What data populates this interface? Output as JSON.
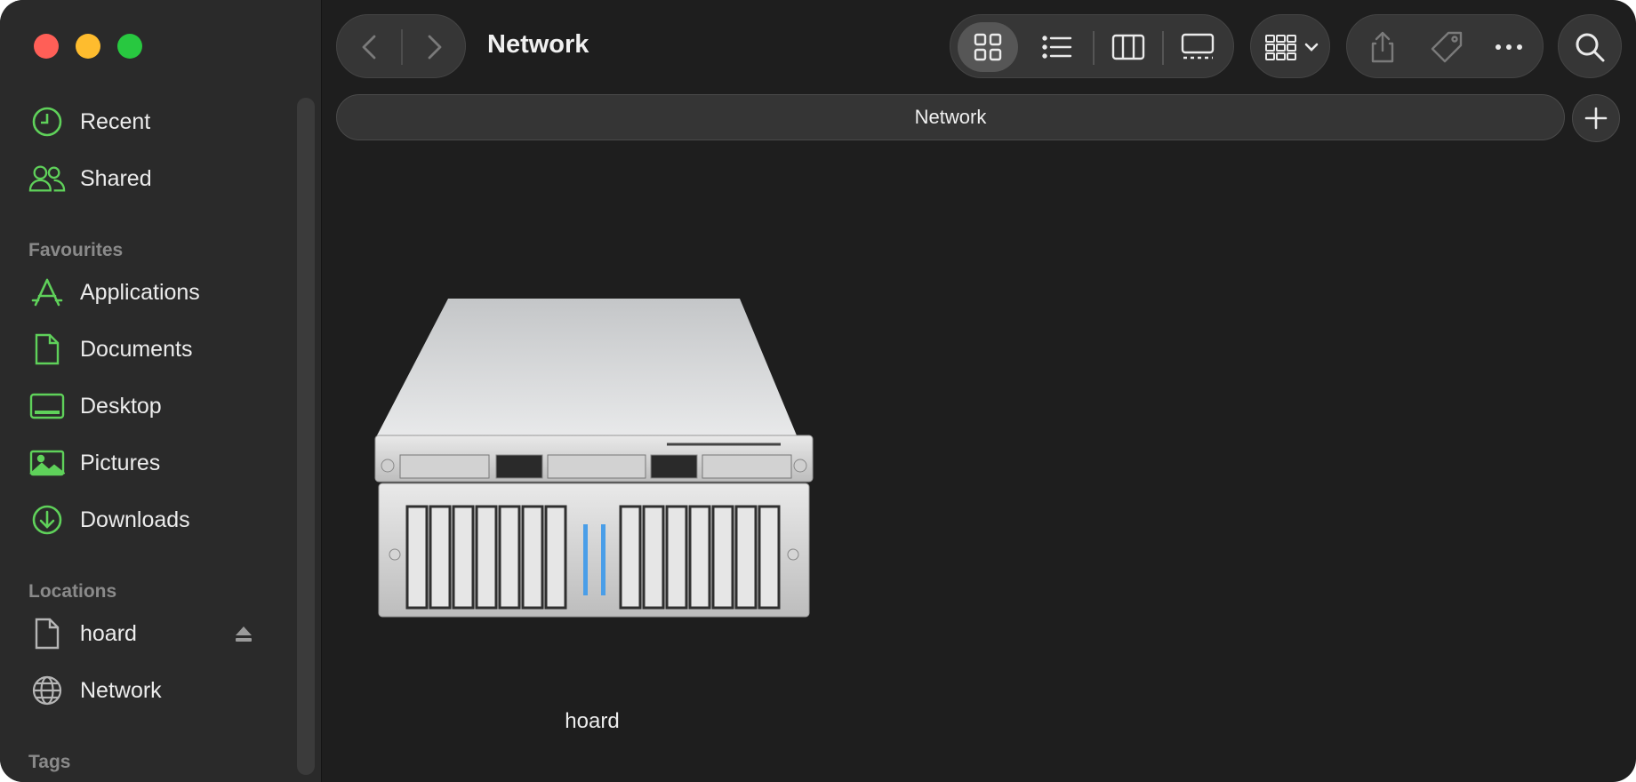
{
  "window": {
    "title": "Network"
  },
  "sidebar": {
    "items": [
      {
        "label": "Recent",
        "icon": "clock-icon"
      },
      {
        "label": "Shared",
        "icon": "people-icon"
      }
    ],
    "favourites_heading": "Favourites",
    "favourites": [
      {
        "label": "Applications",
        "icon": "applications-icon"
      },
      {
        "label": "Documents",
        "icon": "document-icon"
      },
      {
        "label": "Desktop",
        "icon": "desktop-icon"
      },
      {
        "label": "Pictures",
        "icon": "photo-icon"
      },
      {
        "label": "Downloads",
        "icon": "download-icon"
      }
    ],
    "locations_heading": "Locations",
    "locations": [
      {
        "label": "hoard",
        "icon": "document-icon",
        "ejectable": true
      },
      {
        "label": "Network",
        "icon": "globe-icon"
      }
    ],
    "tags_heading": "Tags"
  },
  "toolbar": {
    "view_modes": [
      "icon-view",
      "list-view",
      "column-view",
      "gallery-view"
    ],
    "selected_view": "icon-view"
  },
  "pathbar": {
    "label": "Network"
  },
  "content": {
    "items": [
      {
        "label": "hoard",
        "icon": "server-icon"
      }
    ]
  },
  "colors": {
    "accent": "#5fd15a",
    "background": "#1e1e1e",
    "sidebar": "#2a2a2a"
  }
}
